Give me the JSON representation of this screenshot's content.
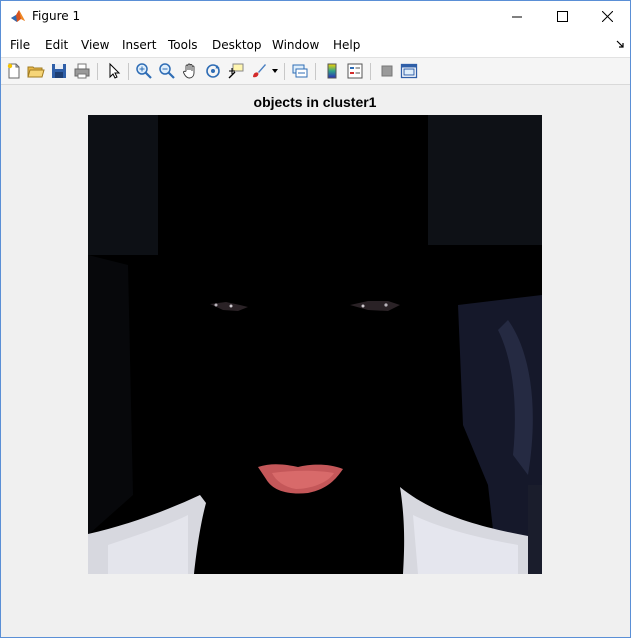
{
  "window": {
    "title": "Figure 1"
  },
  "menu": {
    "items": [
      "File",
      "Edit",
      "View",
      "Insert",
      "Tools",
      "Desktop",
      "Window",
      "Help"
    ]
  },
  "toolbar": {
    "buttons": [
      "new-figure-icon",
      "open-file-icon",
      "save-icon",
      "print-icon",
      "edit-plot-arrow-icon",
      "zoom-in-icon",
      "zoom-out-icon",
      "pan-hand-icon",
      "rotate-3d-icon",
      "data-cursor-icon",
      "brush-icon",
      "link-plot-icon",
      "colorbar-icon",
      "legend-icon",
      "hide-plot-tools-icon",
      "show-plot-tools-icon"
    ]
  },
  "axes": {
    "title": "objects in cluster1"
  },
  "colors": {
    "window_border": "#5a8fd6",
    "figure_background": "#f0f0f0",
    "image_background": "#000000",
    "shirt": "#d8d9e0",
    "lips": "#c8595a"
  }
}
